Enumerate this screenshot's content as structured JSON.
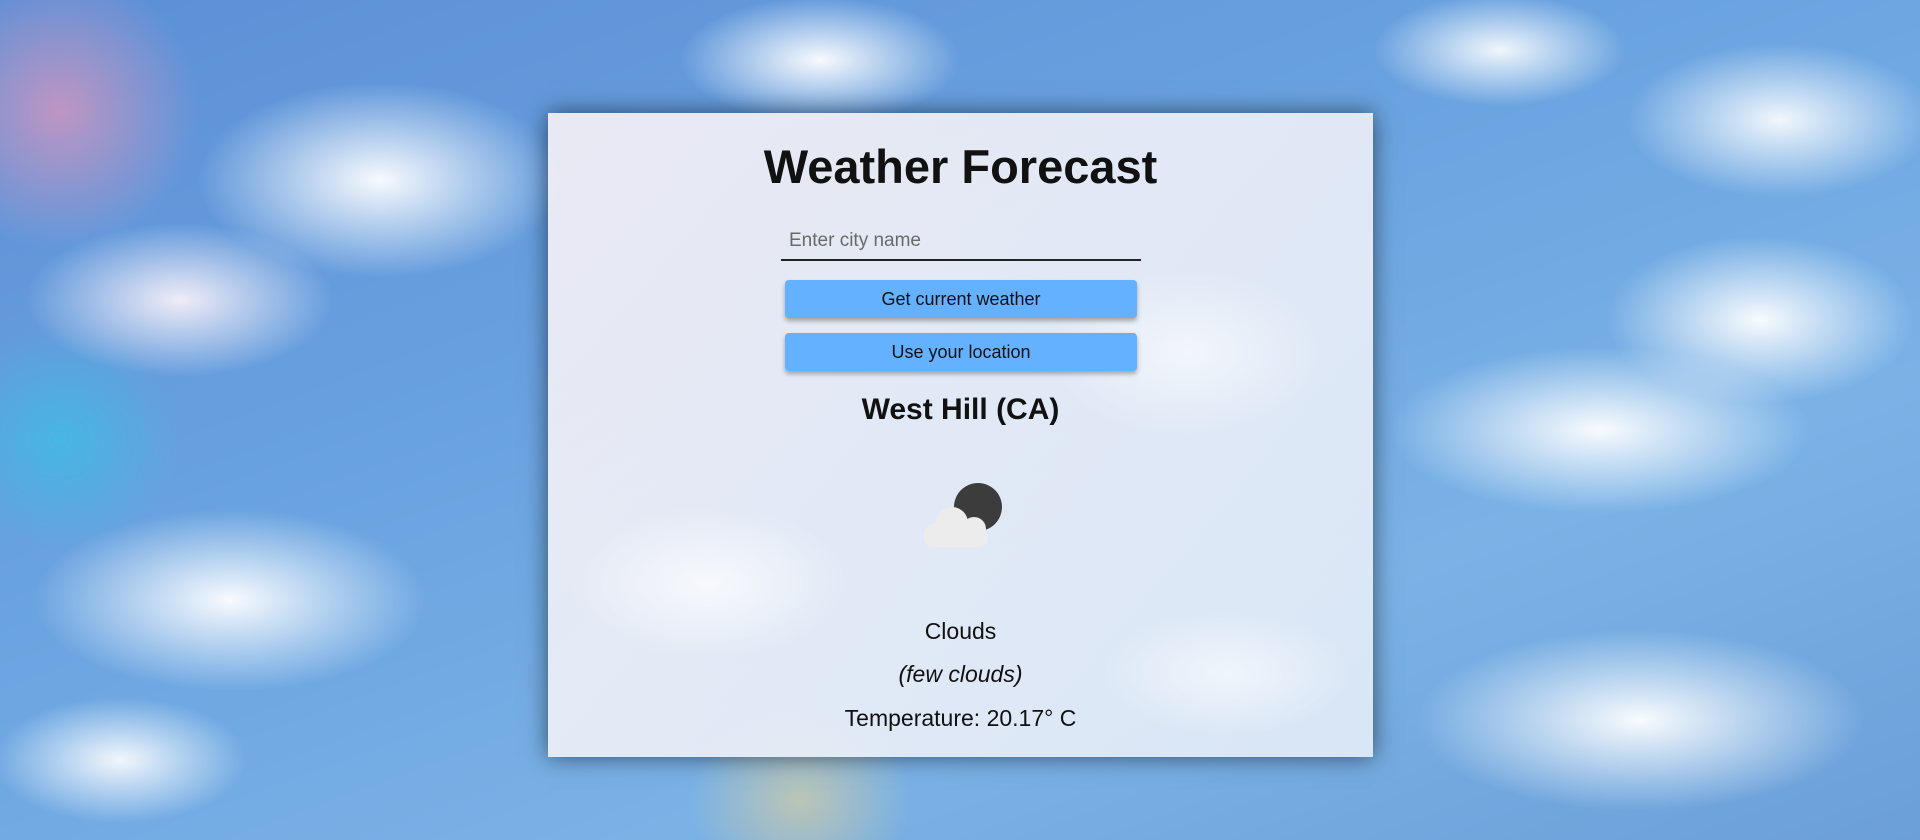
{
  "app": {
    "title": "Weather Forecast"
  },
  "search": {
    "placeholder": "Enter city name",
    "value": ""
  },
  "buttons": {
    "current_weather": "Get current weather",
    "use_location": "Use your location"
  },
  "weather": {
    "location": "West Hill (CA)",
    "icon": "partly-cloudy-night-icon",
    "condition": "Clouds",
    "description": "(few clouds)",
    "temperature": "Temperature: 20.17° C"
  },
  "colors": {
    "button_bg": "#64b1ff",
    "moon": "#3c3c3c",
    "cloud": "#ececec"
  }
}
